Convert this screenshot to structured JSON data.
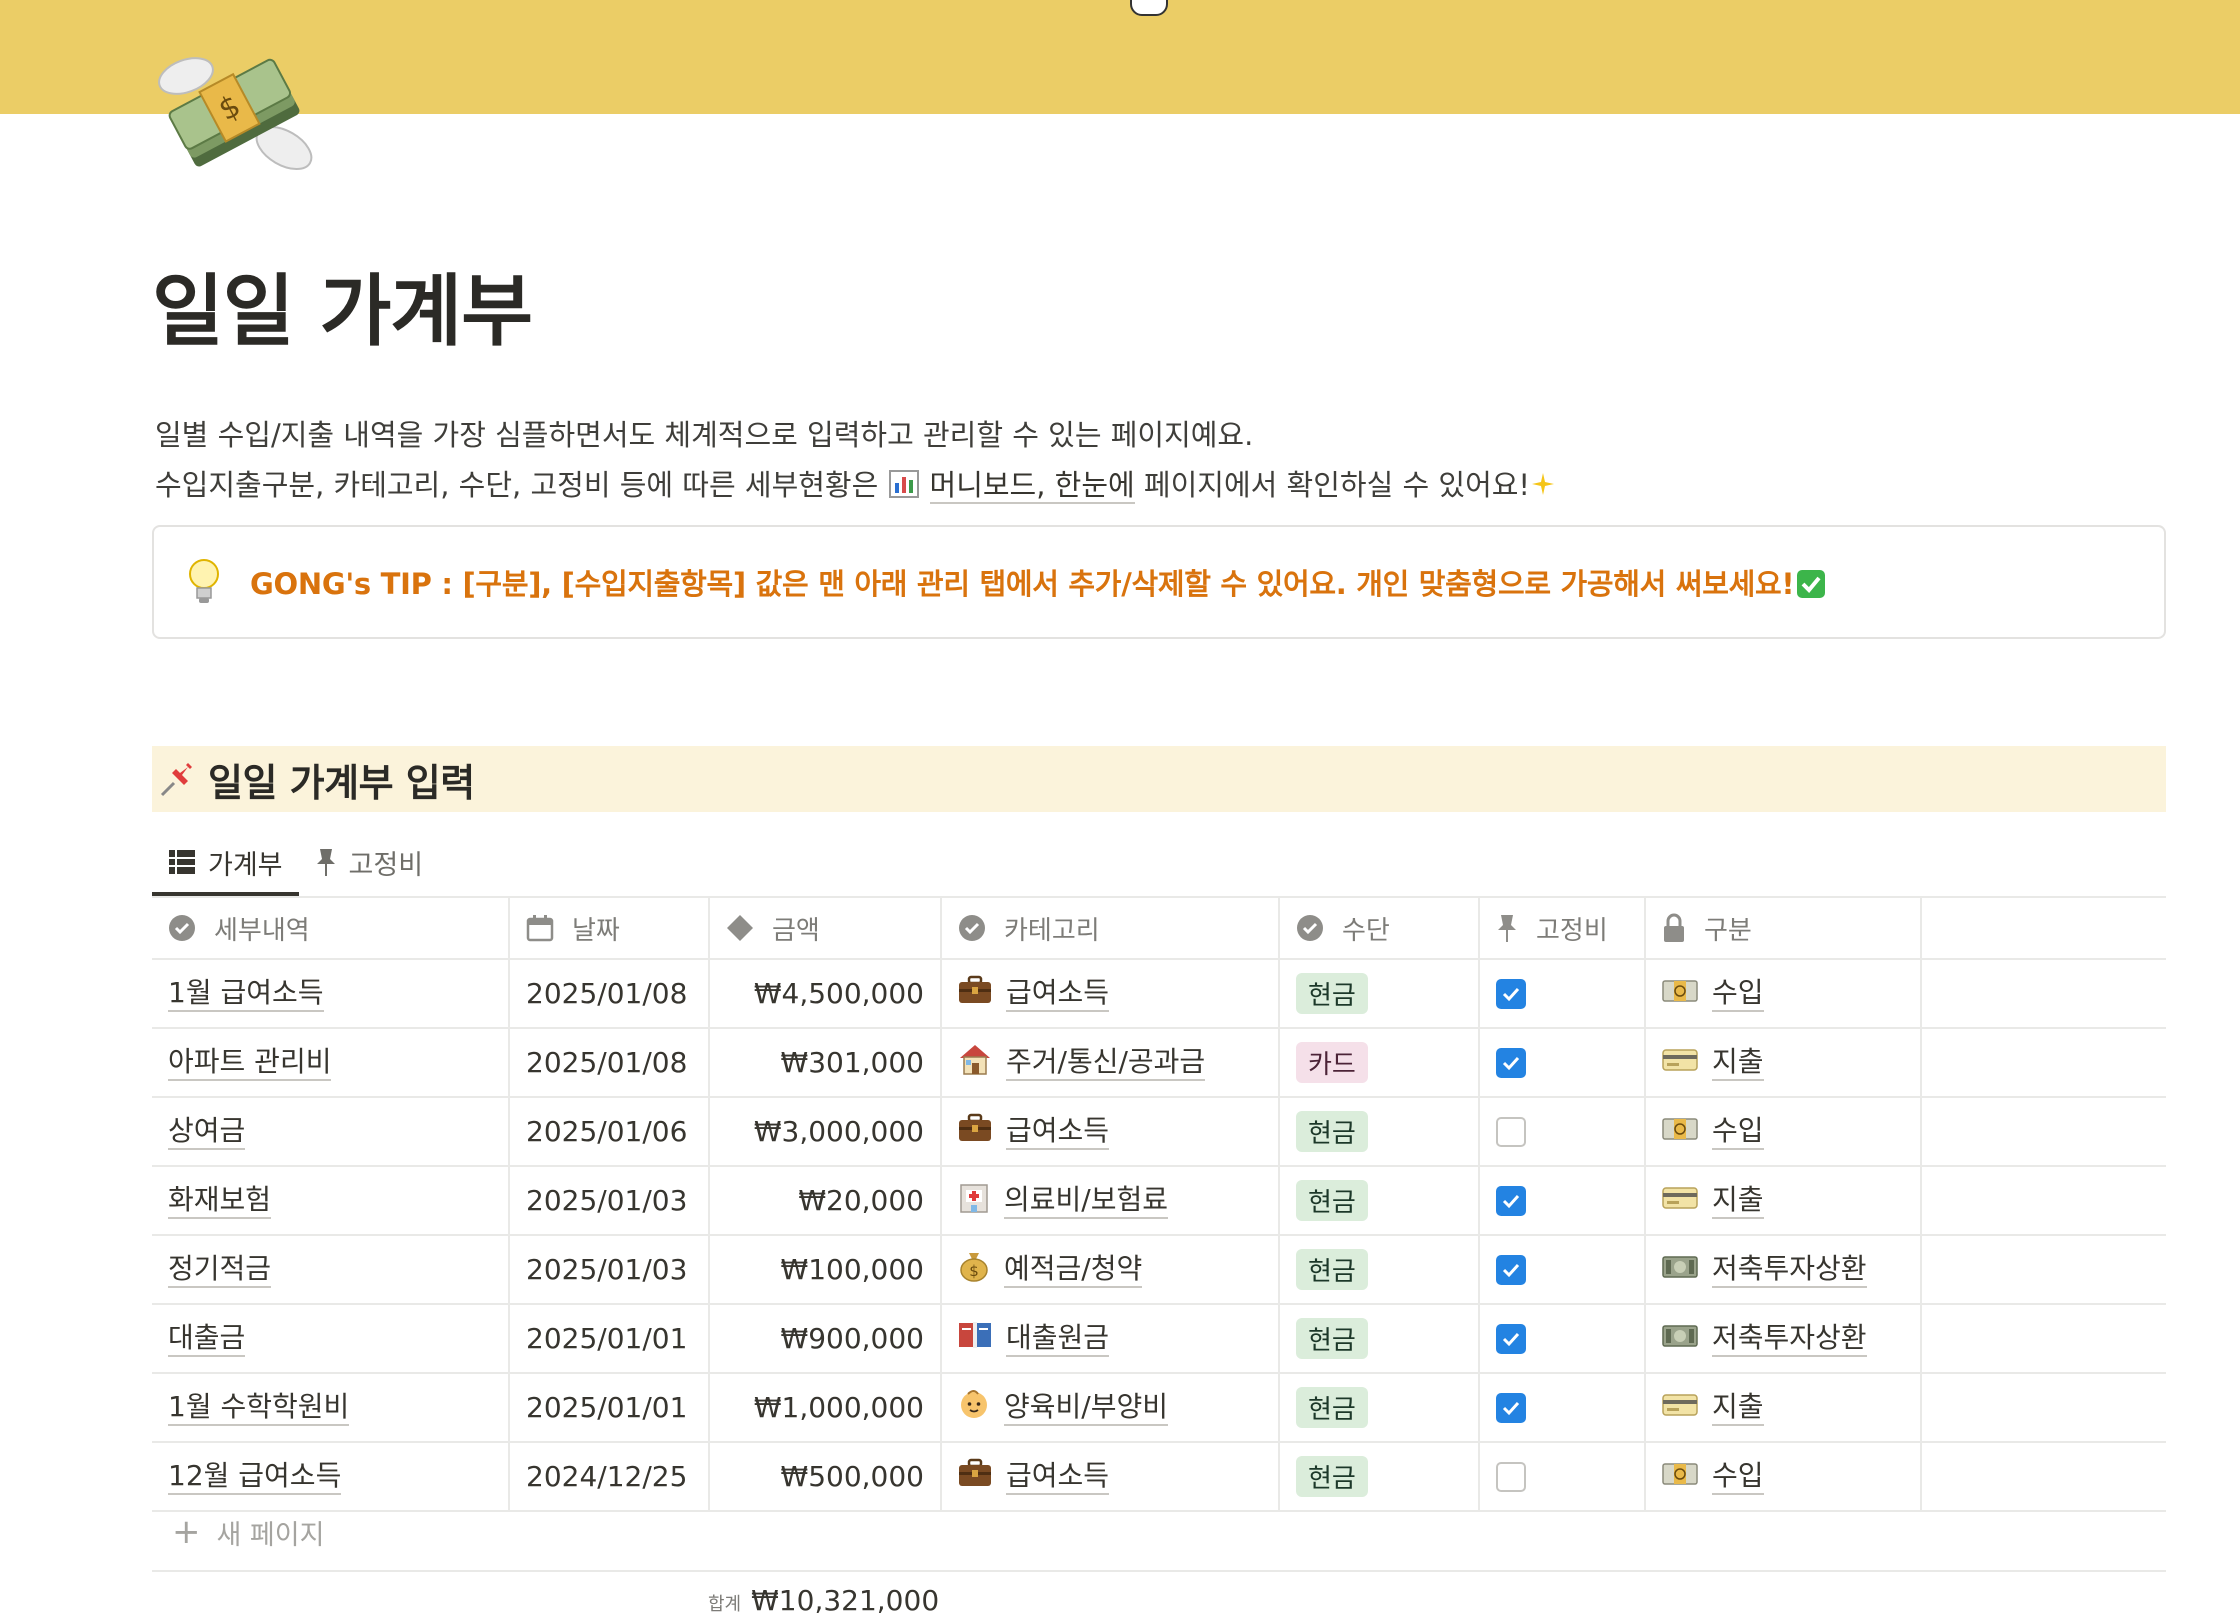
{
  "page": {
    "title": "일일 가계부",
    "desc_line1": "일별 수입/지출 내역을 가장 심플하면서도 체계적으로 입력하고 관리할 수 있는 페이지예요.",
    "desc_line2_a": "수입지출구분, 카테고리, 수단, 고정비 등에 따른 세부현황은 ",
    "desc_link": "머니보드, 한눈에",
    "desc_line2_b": " 페이지에서 확인하실 수 있어요!",
    "tip": "GONG's TIP : [구분], [수입지출항목] 값은 맨 아래 관리 탭에서 추가/삭제할 수 있어요. 개인 맞춤형으로 가공해서 써보세요!"
  },
  "section": {
    "title": "일일 가계부 입력"
  },
  "tabs": [
    {
      "label": "가계부",
      "active": true,
      "icon": "table-icon"
    },
    {
      "label": "고정비",
      "active": false,
      "icon": "pushpin-icon"
    }
  ],
  "columns": {
    "detail": "세부내역",
    "date": "날짜",
    "amount": "금액",
    "category": "카테고리",
    "method": "수단",
    "fixed": "고정비",
    "type": "구분"
  },
  "rows": [
    {
      "detail": "1월 급여소득",
      "date": "2025/01/08",
      "amount": "₩4,500,000",
      "category": "급여소득",
      "category_icon": "briefcase-icon",
      "method": "현금",
      "method_kind": "cash",
      "fixed": true,
      "type": "수입",
      "type_icon": "money-icon"
    },
    {
      "detail": "아파트 관리비",
      "date": "2025/01/08",
      "amount": "₩301,000",
      "category": "주거/통신/공과금",
      "category_icon": "house-icon",
      "method": "카드",
      "method_kind": "card",
      "fixed": true,
      "type": "지출",
      "type_icon": "credit-card-icon"
    },
    {
      "detail": "상여금",
      "date": "2025/01/06",
      "amount": "₩3,000,000",
      "category": "급여소득",
      "category_icon": "briefcase-icon",
      "method": "현금",
      "method_kind": "cash",
      "fixed": false,
      "type": "수입",
      "type_icon": "money-icon"
    },
    {
      "detail": "화재보험",
      "date": "2025/01/03",
      "amount": "₩20,000",
      "category": "의료비/보험료",
      "category_icon": "hospital-icon",
      "method": "현금",
      "method_kind": "cash",
      "fixed": true,
      "type": "지출",
      "type_icon": "credit-card-icon"
    },
    {
      "detail": "정기적금",
      "date": "2025/01/03",
      "amount": "₩100,000",
      "category": "예적금/청약",
      "category_icon": "money-bag-icon",
      "method": "현금",
      "method_kind": "cash",
      "fixed": true,
      "type": "저축투자상환",
      "type_icon": "banknote-icon"
    },
    {
      "detail": "대출금",
      "date": "2025/01/01",
      "amount": "₩900,000",
      "category": "대출원금",
      "category_icon": "bank-book-icon",
      "method": "현금",
      "method_kind": "cash",
      "fixed": true,
      "type": "저축투자상환",
      "type_icon": "banknote-icon"
    },
    {
      "detail": "1월 수학학원비",
      "date": "2025/01/01",
      "amount": "₩1,000,000",
      "category": "양육비/부양비",
      "category_icon": "baby-icon",
      "method": "현금",
      "method_kind": "cash",
      "fixed": true,
      "type": "지출",
      "type_icon": "credit-card-icon"
    },
    {
      "detail": "12월 급여소득",
      "date": "2024/12/25",
      "amount": "₩500,000",
      "category": "급여소득",
      "category_icon": "briefcase-icon",
      "method": "현금",
      "method_kind": "cash",
      "fixed": false,
      "type": "수입",
      "type_icon": "money-icon"
    }
  ],
  "new_page": "새 페이지",
  "summary": {
    "label": "합계",
    "value": "₩10,321,000"
  },
  "colors": {
    "cover": "#ebcd66",
    "tip": "#d9730d",
    "section_bg": "#fbf3db",
    "checkbox": "#2383e2"
  }
}
